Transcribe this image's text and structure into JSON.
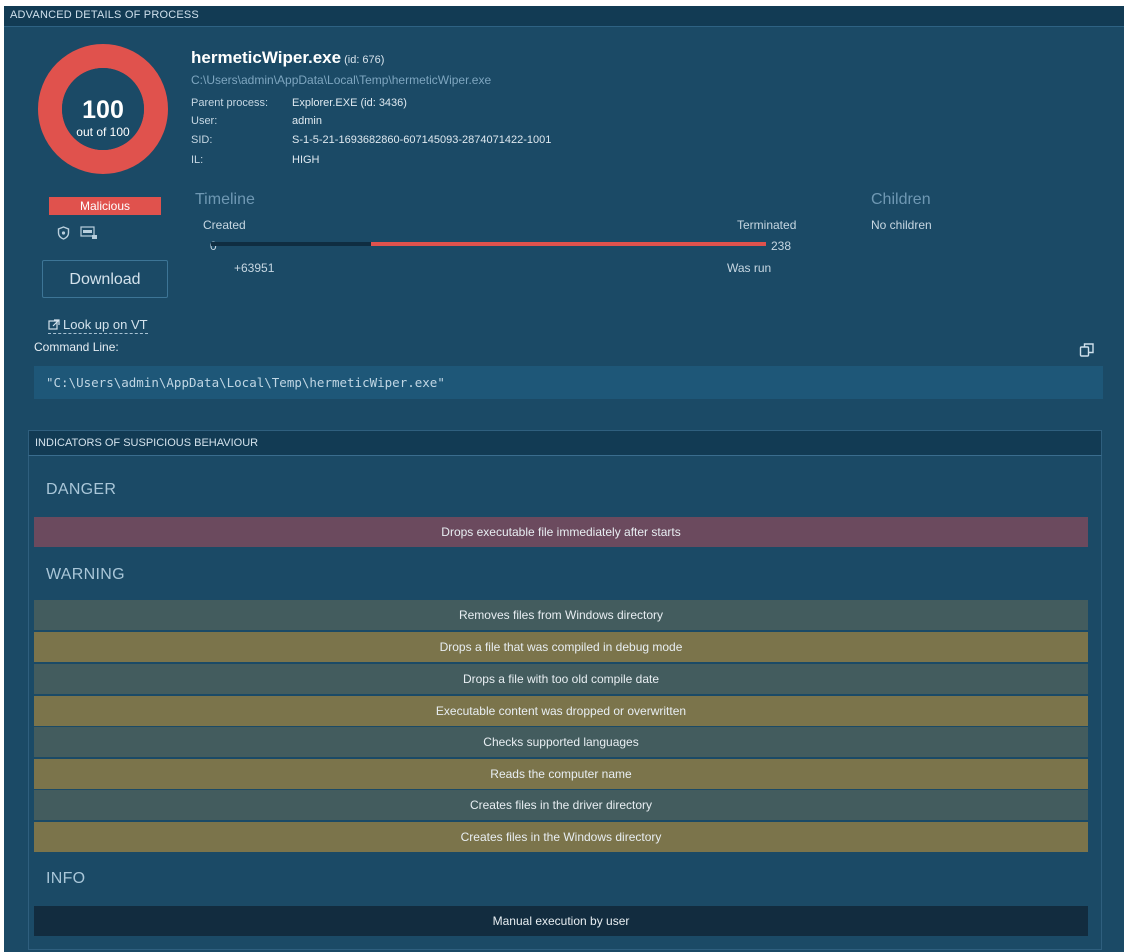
{
  "header": {
    "title": "ADVANCED DETAILS OF PROCESS"
  },
  "score": {
    "value": "100",
    "subtitle": "out of 100",
    "fraction": 1.0,
    "verdict": "Malicious",
    "ring_color": "#e0524d"
  },
  "actions": {
    "download_label": "Download",
    "lookup_label": "Look up on VT"
  },
  "process": {
    "name": "hermeticWiper.exe",
    "id": "(id: 676)",
    "path": "C:\\Users\\admin\\AppData\\Local\\Temp\\hermeticWiper.exe",
    "parent_label": "Parent process:",
    "parent_value": "Explorer.EXE (id: 3436)",
    "user_label": "User:",
    "user_value": "admin",
    "sid_label": "SID:",
    "sid_value": "S-1-5-21-1693682860-607145093-2874071422-1001",
    "il_label": "IL:",
    "il_value": "HIGH"
  },
  "timeline": {
    "title": "Timeline",
    "created_label": "Created",
    "created_value": "0",
    "start_offset": "+63951",
    "terminated_label": "Terminated",
    "terminated_value": "238",
    "was_run_label": "Was run"
  },
  "children": {
    "title": "Children",
    "value": "No children"
  },
  "command_line": {
    "label": "Command Line:",
    "value": "\"C:\\Users\\admin\\AppData\\Local\\Temp\\hermeticWiper.exe\""
  },
  "indicators": {
    "title": "INDICATORS OF SUSPICIOUS BEHAVIOUR",
    "danger_title": "DANGER",
    "danger": [
      "Drops executable file immediately after starts"
    ],
    "warning_title": "WARNING",
    "warning": [
      "Removes files from Windows directory",
      "Drops a file that was compiled in debug mode",
      "Drops a file with too old compile date",
      "Executable content was dropped or overwritten",
      "Checks supported languages",
      "Reads the computer name",
      "Creates files in the driver directory",
      "Creates files in the Windows directory"
    ],
    "info_title": "INFO",
    "info": [
      "Manual execution by user"
    ]
  },
  "colors": {
    "panel_bg": "#1b4a66",
    "danger_row": "#6b4a5e",
    "warning_row_a": "#435c5e",
    "warning_row_b": "#7b744b",
    "info_row": "#122c3f",
    "accent_red": "#e0524d"
  }
}
